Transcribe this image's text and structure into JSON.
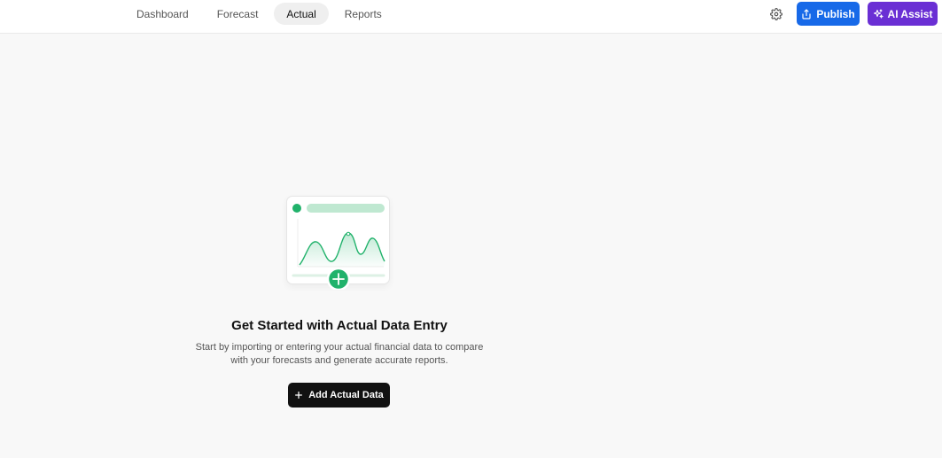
{
  "nav": {
    "tabs": [
      {
        "label": "Dashboard",
        "active": false
      },
      {
        "label": "Forecast",
        "active": false
      },
      {
        "label": "Actual",
        "active": true
      },
      {
        "label": "Reports",
        "active": false
      }
    ]
  },
  "toolbar": {
    "settings_icon": "gear-icon",
    "publish_label": "Publish",
    "publish_icon": "share-upload-icon",
    "ai_label": "AI Assist",
    "ai_icon": "sparkle-icon"
  },
  "empty_state": {
    "title": "Get Started with Actual Data Entry",
    "description_line1": "Start by importing or entering your actual financial data to compare",
    "description_line2": "with your forecasts and generate accurate reports.",
    "button_label": "Add Actual Data",
    "button_icon": "plus-icon"
  },
  "colors": {
    "publish": "#1769e8",
    "ai_assist": "#6a2fd4",
    "accent_green": "#21b26b",
    "primary_button": "#111111"
  }
}
